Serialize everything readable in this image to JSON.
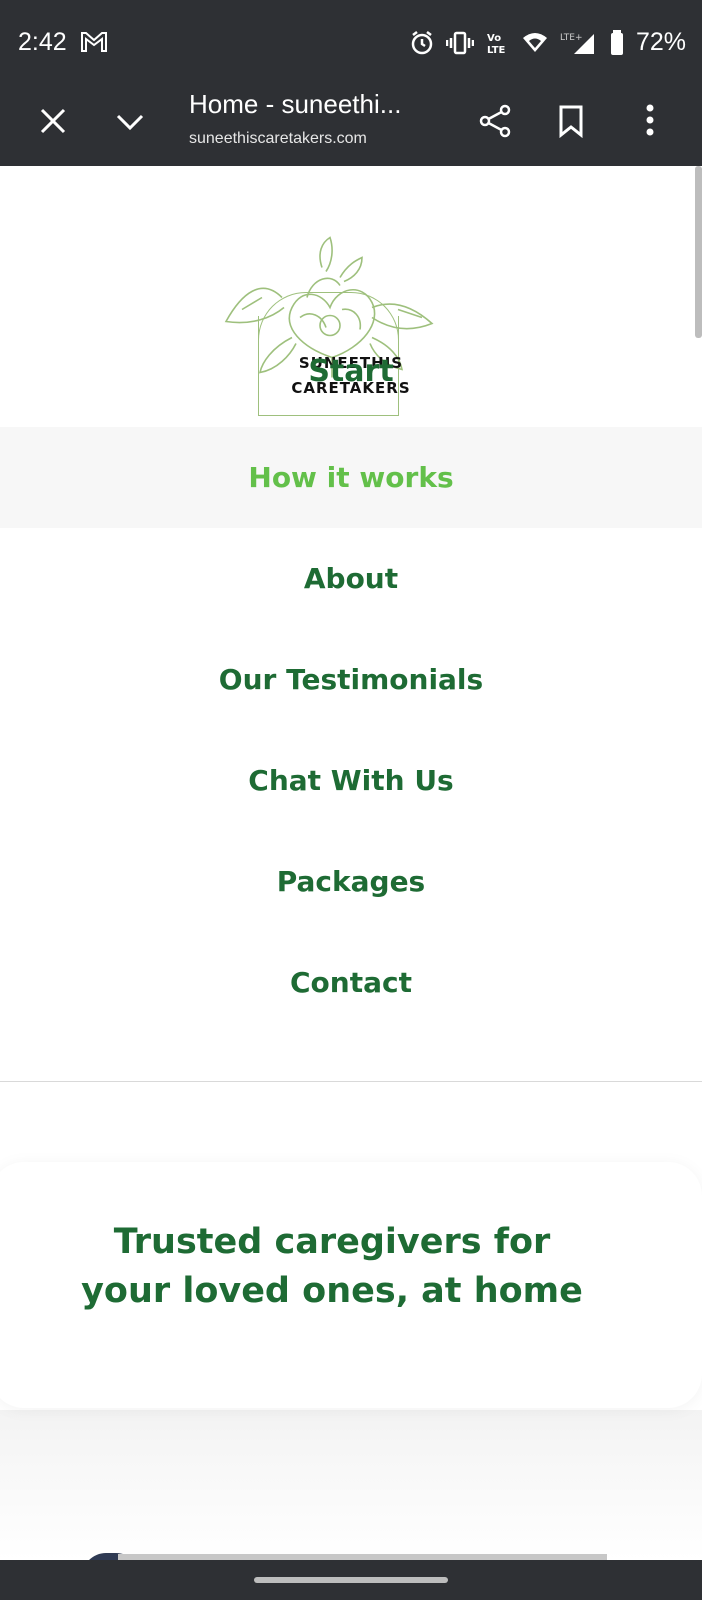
{
  "status_bar": {
    "time": "2:42",
    "battery": "72%",
    "network": "LTE+",
    "volte": "Vo LTE"
  },
  "browser": {
    "title": "Home - suneethi...",
    "url": "suneethiscaretakers.com"
  },
  "logo": {
    "line1": "SUNEETHIS",
    "line2": "CARETAKERS",
    "overlay_text": "Start",
    "accent_color": "#9ec07d"
  },
  "nav": {
    "items": [
      {
        "label": "How it works",
        "active": true
      },
      {
        "label": "About"
      },
      {
        "label": "Our Testimonials"
      },
      {
        "label": "Chat With Us"
      },
      {
        "label": "Packages"
      },
      {
        "label": "Contact"
      }
    ]
  },
  "hero": {
    "line1": "Trusted caregivers for",
    "line2": "your loved ones, at home"
  },
  "colors": {
    "brand_green": "#1e6b34",
    "active_green": "#63c04a",
    "system_bar": "#2e3034"
  },
  "icons": [
    "mail-icon",
    "alarm-icon",
    "vibrate-icon",
    "volte-icon",
    "wifi-icon",
    "signal-icon",
    "battery-icon",
    "close-icon",
    "chevron-down-icon",
    "share-icon",
    "bookmark-icon",
    "more-vert-icon"
  ]
}
